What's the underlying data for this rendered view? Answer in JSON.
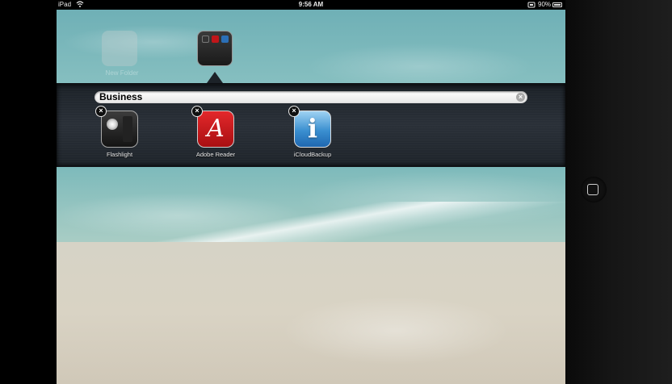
{
  "status_bar": {
    "carrier": "iPad",
    "time": "9:56 AM",
    "battery": "90%"
  },
  "home": {
    "ghost_folder_label": "New Folder"
  },
  "folder": {
    "name": "Business",
    "apps": [
      {
        "label": "Flashlight"
      },
      {
        "label": "Adobe Reader"
      },
      {
        "label": "iCloudBackup"
      }
    ]
  },
  "icons": {
    "adobe_glyph": "A",
    "icloud_glyph": "i",
    "delete": "×",
    "clear": "×"
  }
}
